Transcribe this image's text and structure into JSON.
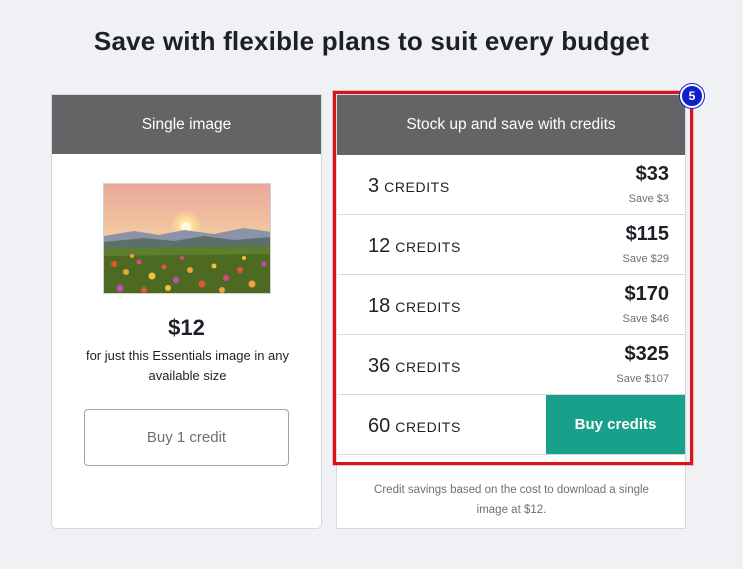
{
  "page": {
    "title": "Save with flexible plans to suit every budget"
  },
  "single": {
    "header": "Single image",
    "price": "$12",
    "description": "for just this Essentials image in any available size",
    "button_label": "Buy 1 credit"
  },
  "credits": {
    "header": "Stock up and save with credits",
    "unit_label": "CREDITS",
    "options": [
      {
        "quantity": "3",
        "price": "$33",
        "save": "Save $3"
      },
      {
        "quantity": "12",
        "price": "$115",
        "save": "Save $29"
      },
      {
        "quantity": "18",
        "price": "$170",
        "save": "Save $46"
      },
      {
        "quantity": "36",
        "price": "$325",
        "save": "Save $107"
      },
      {
        "quantity": "60"
      }
    ],
    "button_label": "Buy credits",
    "note": "Credit savings based on the cost to download a single image at $12."
  },
  "annotation": {
    "marker": "5",
    "color": "#d6141b"
  },
  "colors": {
    "header_bg": "#626466",
    "accent": "#18a18a"
  }
}
